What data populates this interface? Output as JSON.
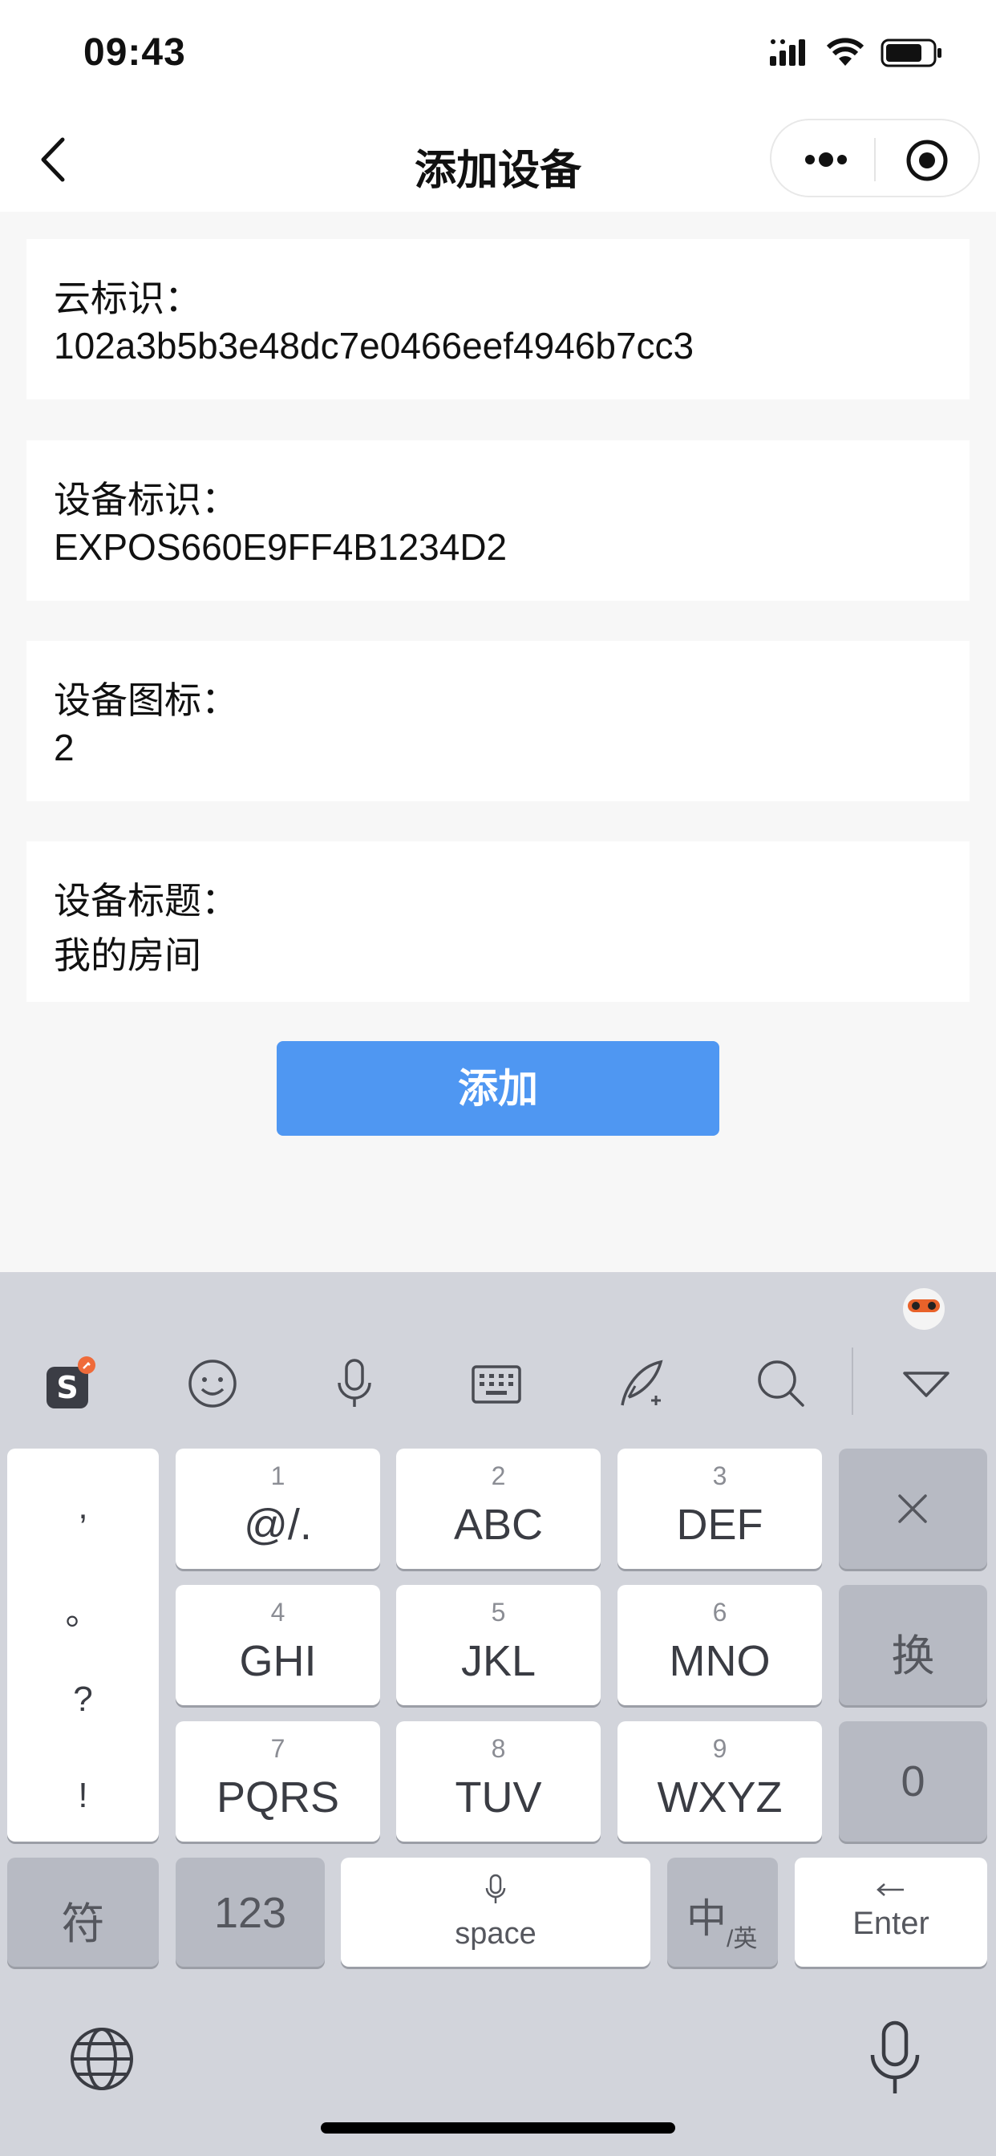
{
  "status": {
    "time": "09:43"
  },
  "nav": {
    "title": "添加设备"
  },
  "fields": [
    {
      "label": "云标识：",
      "value": "102a3b5b3e48dc7e0466eef4946b7cc3"
    },
    {
      "label": "设备标识：",
      "value": "EXPOS660E9FF4B1234D2"
    },
    {
      "label": "设备图标：",
      "value": "2"
    },
    {
      "label": "设备标题：",
      "value": "我的房间"
    }
  ],
  "add_button": "添加",
  "keyboard": {
    "punct": [
      ",",
      "。",
      "?",
      "!"
    ],
    "keys": [
      {
        "num": "1",
        "text": "@/."
      },
      {
        "num": "2",
        "text": "ABC"
      },
      {
        "num": "3",
        "text": "DEF"
      },
      {
        "num": "4",
        "text": "GHI"
      },
      {
        "num": "5",
        "text": "JKL"
      },
      {
        "num": "6",
        "text": "MNO"
      },
      {
        "num": "7",
        "text": "PQRS"
      },
      {
        "num": "8",
        "text": "TUV"
      },
      {
        "num": "9",
        "text": "WXYZ"
      }
    ],
    "switch_label": "换",
    "zero_label": "0",
    "symbol_label": "符",
    "num_label": "123",
    "space_label": "space",
    "lang_main": "中",
    "lang_sub": "/英",
    "enter_label": "Enter"
  }
}
